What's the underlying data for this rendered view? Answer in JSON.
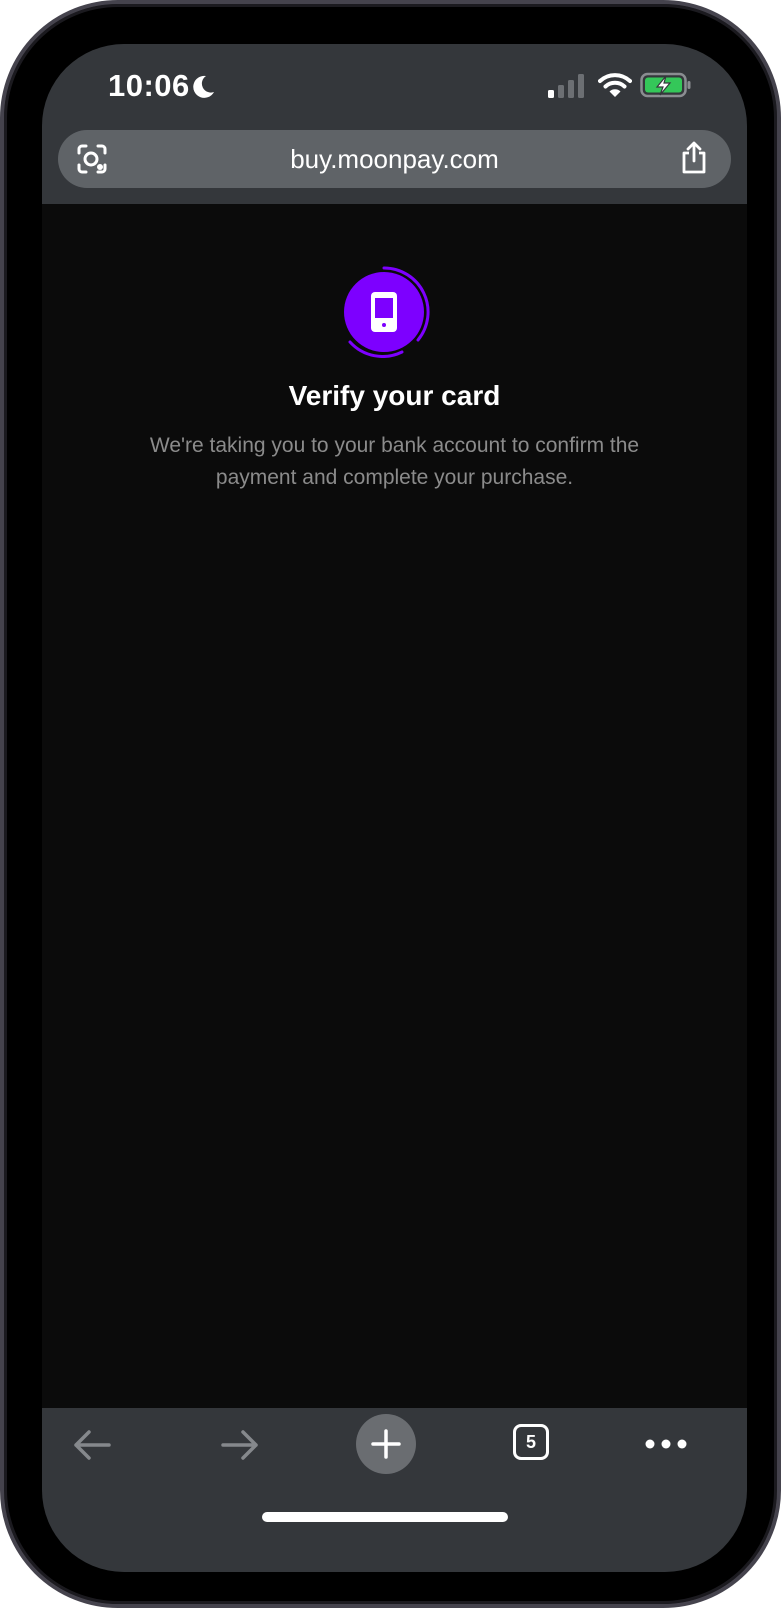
{
  "status_bar": {
    "time": "10:06",
    "icons": [
      "moon-icon",
      "cellular-signal-icon",
      "wifi-icon",
      "battery-charging-icon"
    ]
  },
  "browser": {
    "url": "buy.moonpay.com",
    "left_icon": "lens-icon",
    "right_icon": "share-icon",
    "tab_count": "5"
  },
  "main": {
    "icon": "phone-verify-icon",
    "title": "Verify your card",
    "message": "We're taking you to your bank account to confirm the payment and complete your purchase."
  },
  "toolbar": {
    "icons": [
      "back-arrow-icon",
      "forward-arrow-icon",
      "plus-icon",
      "tabs-icon",
      "more-icon"
    ]
  },
  "colors": {
    "accent": "#7d00ff",
    "chrome": "#34373b",
    "address_bar": "#5f6367",
    "background": "#0b0b0b",
    "muted_text": "#8b8b8b",
    "battery_fill": "#34c759"
  }
}
